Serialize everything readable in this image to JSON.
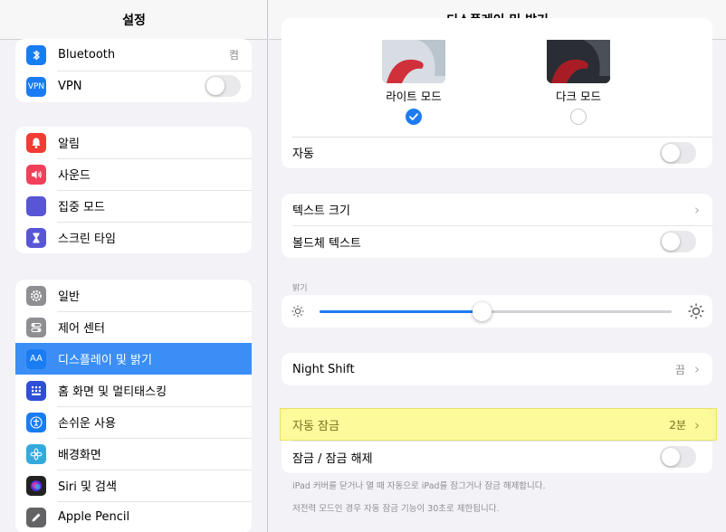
{
  "sidebar": {
    "title": "설정",
    "groups": [
      [
        {
          "label": "Bluetooth",
          "icon": "bluetooth-icon",
          "color": "#1a7cf2",
          "value": "켬"
        },
        {
          "label": "VPN",
          "icon": "vpn-icon",
          "color": "#1a7cf2",
          "icon_text": "VPN",
          "toggle": "off"
        }
      ],
      [
        {
          "label": "알림",
          "icon": "bell-icon",
          "color": "#f23c34"
        },
        {
          "label": "사운드",
          "icon": "speaker-icon",
          "color": "#f2405a"
        },
        {
          "label": "집중 모드",
          "icon": "moon-icon",
          "color": "#5856d6"
        },
        {
          "label": "스크린 타임",
          "icon": "hourglass-icon",
          "color": "#5856d6"
        }
      ],
      [
        {
          "label": "일반",
          "icon": "gear-icon",
          "color": "#8e8e93"
        },
        {
          "label": "제어 센터",
          "icon": "toggles-icon",
          "color": "#8e8e93"
        },
        {
          "label": "디스플레이 및 밝기",
          "icon": "text-size-icon",
          "color": "#1a7cf2",
          "icon_text": "AA",
          "selected": true
        },
        {
          "label": "홈 화면 및 멀티태스킹",
          "icon": "home-grid-icon",
          "color": "#2f4fd6"
        },
        {
          "label": "손쉬운 사용",
          "icon": "accessibility-icon",
          "color": "#1a7cf2"
        },
        {
          "label": "배경화면",
          "icon": "flower-icon",
          "color": "#34aadc"
        },
        {
          "label": "Siri 및 검색",
          "icon": "siri-icon",
          "color": "#222222"
        },
        {
          "label": "Apple Pencil",
          "icon": "pencil-icon",
          "color": "#636366"
        }
      ]
    ]
  },
  "main": {
    "title": "디스플레이 및 밝기",
    "appearance": {
      "light_label": "라이트 모드",
      "dark_label": "다크 모드",
      "selected": "light",
      "auto_label": "자동",
      "auto_toggle": "off"
    },
    "text": {
      "text_size_label": "텍스트 크기",
      "bold_text_label": "볼드체 텍스트",
      "bold_toggle": "off"
    },
    "brightness": {
      "section_label": "밝기",
      "level": 0.46
    },
    "night_shift": {
      "label": "Night Shift",
      "value": "끔"
    },
    "lock": {
      "auto_lock_label": "자동 잠금",
      "auto_lock_value": "2분",
      "lock_unlock_label": "잠금 / 잠금 해제",
      "lock_toggle": "off",
      "note1": "iPad 커버를 닫거나 열 때 자동으로 iPad를 잠그거나 잠금 해제합니다.",
      "note2": "저전력 모드인 경우 자동 잠금 기능이 30초로 제한됩니다."
    },
    "highlight_color": "#fdf97a"
  }
}
